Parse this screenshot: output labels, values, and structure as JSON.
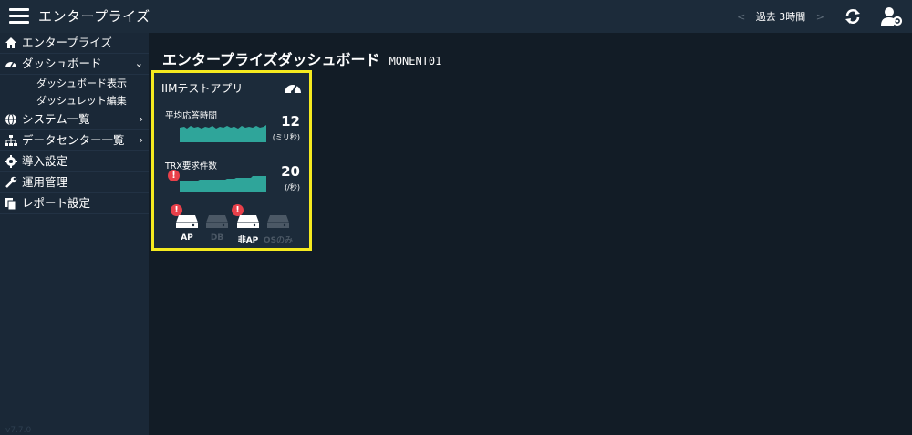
{
  "header": {
    "title": "エンタープライズ",
    "time_range": "過去 3時間",
    "prev": "<",
    "next": ">"
  },
  "sidebar": {
    "items": [
      {
        "label": "エンタープライズ",
        "icon": "home-icon"
      },
      {
        "label": "ダッシュボード",
        "icon": "dashboard-icon",
        "expanded": true,
        "children": [
          {
            "label": "ダッシュボード表示"
          },
          {
            "label": "ダッシュレット編集"
          }
        ]
      },
      {
        "label": "システム一覧",
        "icon": "globe-icon"
      },
      {
        "label": "データセンター一覧",
        "icon": "sitemap-icon"
      },
      {
        "label": "導入設定",
        "icon": "gear-icon"
      },
      {
        "label": "運用管理",
        "icon": "wrench-icon"
      },
      {
        "label": "レポート設定",
        "icon": "copy-icon"
      }
    ],
    "version": "v7.7.0"
  },
  "main": {
    "title": "エンタープライズダッシュボード",
    "subtitle": "MONENT01"
  },
  "card": {
    "title": "IIMテストアプリ",
    "metric1": {
      "label": "平均応答時間",
      "value": "12",
      "unit": "(ミリ秒)"
    },
    "metric2": {
      "label": "TRX要求件数",
      "value": "20",
      "unit": "(/秒)"
    },
    "servers": [
      {
        "label": "AP",
        "active": true,
        "alert": true
      },
      {
        "label": "DB",
        "active": false,
        "alert": false
      },
      {
        "label": "非AP",
        "active": true,
        "alert": true
      },
      {
        "label": "OSのみ",
        "active": false,
        "alert": false
      }
    ]
  },
  "colors": {
    "accent": "#2fa59a",
    "highlight": "#f5ea1f",
    "alert": "#e8404a",
    "bg": "#121c26",
    "panel": "#1c2b3a"
  },
  "icons": {
    "alert": "!"
  }
}
